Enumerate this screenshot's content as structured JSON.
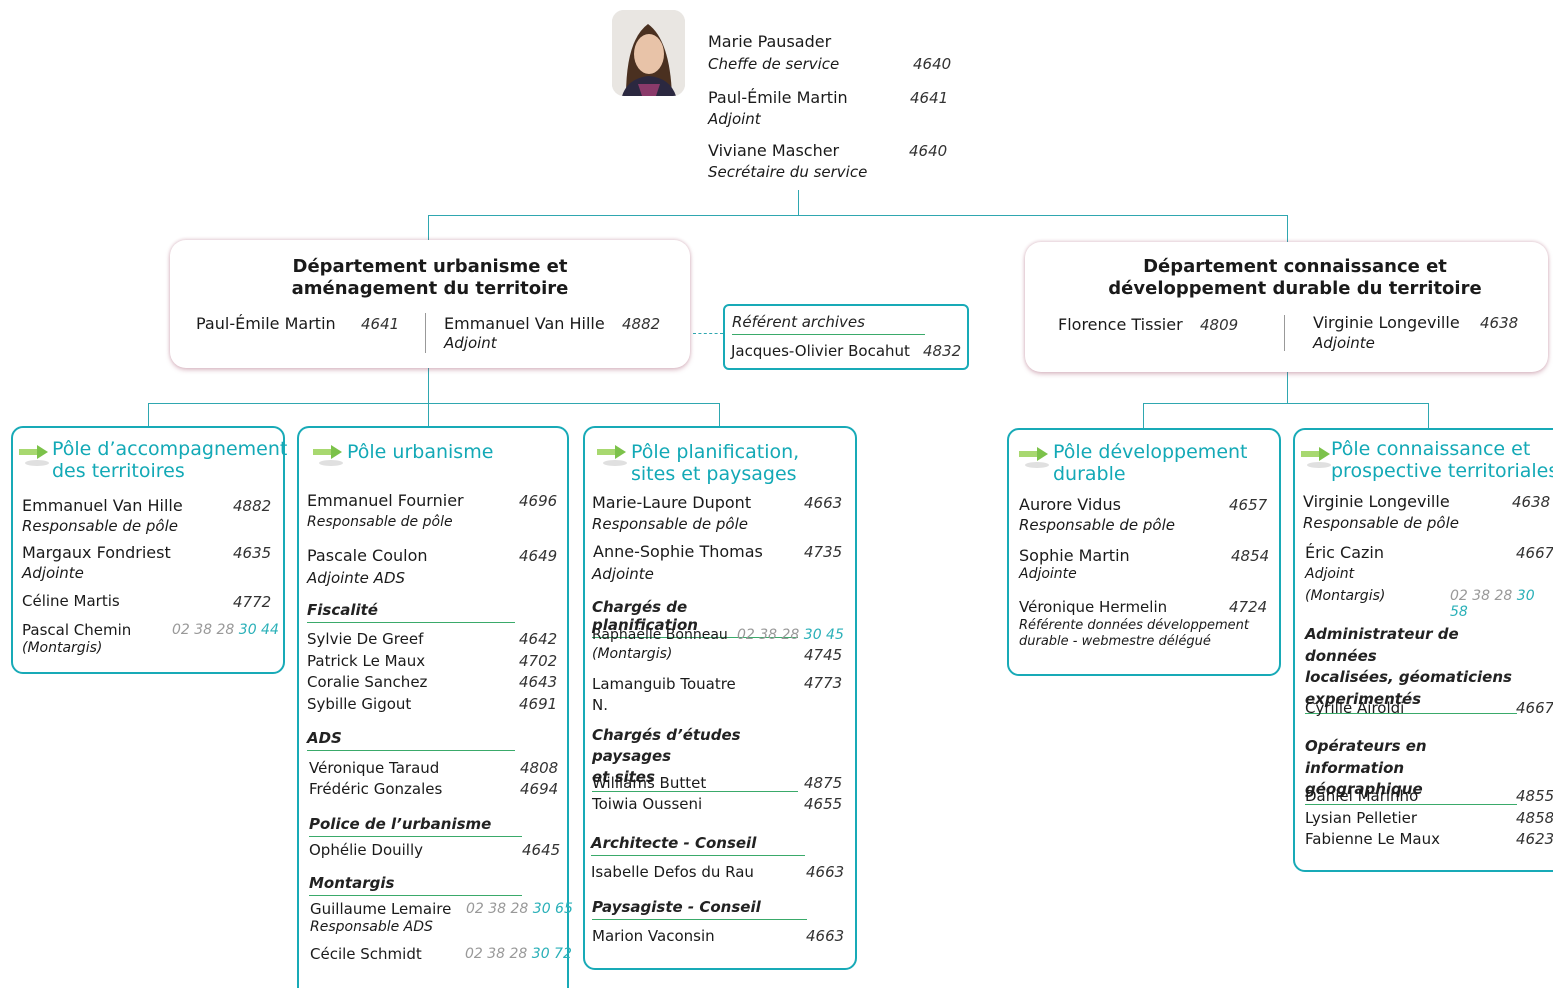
{
  "top": {
    "chef_name": "Marie Pausader",
    "chef_role": "Cheffe de service",
    "chef_num": "4640",
    "adj_name": "Paul-Émile Martin",
    "adj_role": "Adjoint",
    "adj_num": "4641",
    "sec_name": "Viviane Mascher",
    "sec_role": "Secrétaire du service",
    "sec_num": "4640"
  },
  "dept1": {
    "title1": "Département urbanisme et",
    "title2": "aménagement du territoire",
    "head_name": "Paul-Émile Martin",
    "head_num": "4641",
    "adj_name": "Emmanuel Van Hille",
    "adj_num": "4882",
    "adj_role": "Adjoint"
  },
  "archives": {
    "title": "Référent archives",
    "name": "Jacques-Olivier Bocahut",
    "num": "4832"
  },
  "dept2": {
    "title1": "Département connaissance et",
    "title2": "développement durable du territoire",
    "head_name": "Florence Tissier",
    "head_num": "4809",
    "adj_name": "Virginie Longeville",
    "adj_num": "4638",
    "adj_role": "Adjointe"
  },
  "pole1": {
    "title1": "Pôle d’accompagnement",
    "title2": "des territoires",
    "p1_name": "Emmanuel Van Hille",
    "p1_num": "4882",
    "p1_role": "Responsable de pôle",
    "p2_name": "Margaux Fondriest",
    "p2_num": "4635",
    "p2_role": "Adjointe",
    "p3_name": "Céline Martis",
    "p3_num": "4772",
    "p4_name": "Pascal Chemin",
    "p4_tel": "02 38 28 ",
    "p4_ext": "30 44",
    "p4_loc": "(Montargis)"
  },
  "pole2": {
    "title": "Pôle urbanisme",
    "p1_name": "Emmanuel Fournier",
    "p1_num": "4696",
    "p1_role": "Responsable de pôle",
    "p2_name": "Pascale Coulon",
    "p2_num": "4649",
    "p2_role": "Adjointe ADS",
    "sec_fisc": "Fiscalité",
    "fisc": [
      {
        "name": "Sylvie De Greef",
        "num": "4642"
      },
      {
        "name": "Patrick Le Maux",
        "num": "4702"
      },
      {
        "name": "Coralie Sanchez",
        "num": "4643"
      },
      {
        "name": "Sybille Gigout",
        "num": "4691"
      }
    ],
    "sec_ads": "ADS",
    "ads": [
      {
        "name": "Véronique Taraud",
        "num": "4808"
      },
      {
        "name": "Frédéric Gonzales",
        "num": "4694"
      }
    ],
    "sec_police": "Police de l’urbanisme",
    "police_name": "Ophélie Douilly",
    "police_num": "4645",
    "sec_mont": "Montargis",
    "m1_name": "Guillaume Lemaire",
    "m1_tel": "02 38 28 ",
    "m1_ext": "30 65",
    "m1_role": "Responsable ADS",
    "m2_name": "Cécile Schmidt",
    "m2_tel": "02 38 28 ",
    "m2_ext": "30 72"
  },
  "pole3": {
    "title1": "Pôle planification,",
    "title2": "sites et paysages",
    "p1_name": "Marie-Laure Dupont",
    "p1_num": "4663",
    "p1_role": "Responsable de pôle",
    "p2_name": "Anne-Sophie Thomas",
    "p2_num": "4735",
    "p2_role": "Adjointe",
    "sec_plan": "Chargés de planification",
    "r_name": "Raphaëlle Bonneau",
    "r_tel": "02 38 28 ",
    "r_ext": "30 45",
    "r_loc": "(Montargis)",
    "r_num": "4745",
    "l_name1": "Lamanguib Touatre",
    "l_name2": "N.",
    "l_num": "4773",
    "sec_etudes1": "Chargés d’études paysages",
    "sec_etudes2": "et sites",
    "etudes": [
      {
        "name": "Williams Buttet",
        "num": "4875"
      },
      {
        "name": "Toiwia Ousseni",
        "num": "4655"
      }
    ],
    "sec_archi": "Architecte - Conseil",
    "archi_name": "Isabelle Defos du Rau",
    "archi_num": "4663",
    "sec_pays": "Paysagiste - Conseil",
    "pays_name": "Marion Vaconsin",
    "pays_num": "4663"
  },
  "pole4": {
    "title1": "Pôle développement",
    "title2": "durable",
    "p1_name": "Aurore Vidus",
    "p1_num": "4657",
    "p1_role": "Responsable de pôle",
    "p2_name": "Sophie Martin",
    "p2_num": "4854",
    "p2_role": "Adjointe",
    "p3_name": "Véronique Hermelin",
    "p3_num": "4724",
    "p3_role1": "Référente données développement",
    "p3_role2": "durable - webmestre délégué"
  },
  "pole5": {
    "title1": "Pôle connaissance et",
    "title2": "prospective territoriales",
    "p1_name": "Virginie Longeville",
    "p1_num": "4638",
    "p1_role": "Responsable de pôle",
    "p2_name": "Éric Cazin",
    "p2_num": "4667",
    "p2_role": "Adjoint",
    "p2_loc": "(Montargis)",
    "p2_tel": "02 38 28 ",
    "p2_ext": "30 58",
    "sec_admin1": "Administrateur de données",
    "sec_admin2": "localisées, géomaticiens",
    "sec_admin3": "experimentés",
    "admin_name": "Cyrille Airoldi",
    "admin_num": "4667",
    "sec_oper1": "Opérateurs en information",
    "sec_oper2": "géographique",
    "oper": [
      {
        "name": "Daniel Marinho",
        "num": "4855"
      },
      {
        "name": "Lysian Pelletier",
        "num": "4858"
      },
      {
        "name": "Fabienne Le Maux",
        "num": "4623"
      }
    ]
  }
}
